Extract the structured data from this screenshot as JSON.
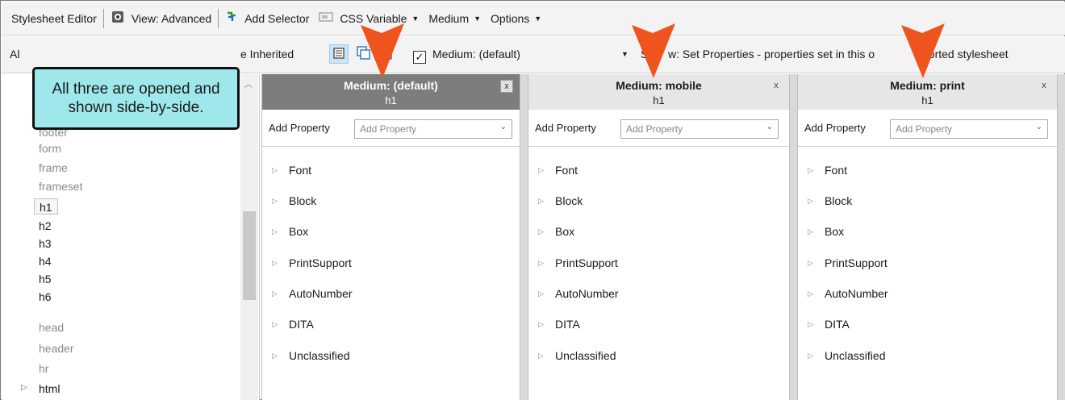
{
  "toolbar": {
    "title": "Stylesheet Editor",
    "view": "View: Advanced",
    "add_selector": "Add Selector",
    "css_variable": "CSS Variable",
    "medium": "Medium",
    "options": "Options"
  },
  "toolbar2": {
    "left_text": "Al",
    "inherited_text": "e Inherited",
    "medium_checkbox_label": "Medium: (default)",
    "medium_checked": true,
    "show_prefix": "S",
    "show_text_1": "w: Set Properties - properties set in this o",
    "show_text_2": "ported stylesheet"
  },
  "callout": {
    "text": "All three are opened and shown side-by-side."
  },
  "tree": {
    "items": [
      {
        "label": "footer",
        "style": "gray"
      },
      {
        "label": "form",
        "style": "gray"
      },
      {
        "label": "frame",
        "style": "gray"
      },
      {
        "label": "frameset",
        "style": "gray"
      },
      {
        "label": "h1",
        "style": "selected"
      },
      {
        "label": "h2",
        "style": "normal"
      },
      {
        "label": "h3",
        "style": "normal"
      },
      {
        "label": "h4",
        "style": "normal"
      },
      {
        "label": "h5",
        "style": "normal"
      },
      {
        "label": "h6",
        "style": "normal"
      },
      {
        "label": "head",
        "style": "gray"
      },
      {
        "label": "header",
        "style": "gray"
      },
      {
        "label": "hr",
        "style": "gray"
      },
      {
        "label": "html",
        "style": "normal"
      }
    ]
  },
  "panels": [
    {
      "title": "Medium: (default)",
      "subtitle": "h1",
      "active": true,
      "close": "x",
      "add_label": "Add Property",
      "add_placeholder": "Add Property",
      "groups": [
        "Font",
        "Block",
        "Box",
        "PrintSupport",
        "AutoNumber",
        "DITA",
        "Unclassified"
      ]
    },
    {
      "title": "Medium: mobile",
      "subtitle": "h1",
      "active": false,
      "close": "x",
      "add_label": "Add Property",
      "add_placeholder": "Add Property",
      "groups": [
        "Font",
        "Block",
        "Box",
        "PrintSupport",
        "AutoNumber",
        "DITA",
        "Unclassified"
      ]
    },
    {
      "title": "Medium: print",
      "subtitle": "h1",
      "active": false,
      "close": "x",
      "add_label": "Add Property",
      "add_placeholder": "Add Property",
      "groups": [
        "Font",
        "Block",
        "Box",
        "PrintSupport",
        "AutoNumber",
        "DITA",
        "Unclassified"
      ]
    }
  ],
  "colors": {
    "callout_bg": "#9ee8ec",
    "arrow": "#f0541e",
    "active_header": "#7d7d7d",
    "header": "#e6e6e6",
    "selected_button": "#cce4f7"
  }
}
